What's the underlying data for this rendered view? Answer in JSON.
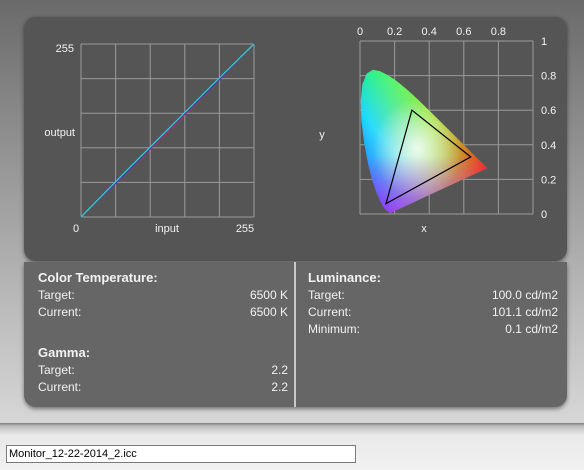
{
  "gamma_chart": {
    "xlabel": "input",
    "ylabel": "output",
    "x_ticks": [
      "0",
      "255"
    ],
    "y_ticks": [
      "255"
    ]
  },
  "cie_chart": {
    "xlabel": "x",
    "ylabel": "y",
    "x_ticks": [
      "0",
      "0.2",
      "0.4",
      "0.6",
      "0.8"
    ],
    "y_ticks": [
      "1",
      "0.8",
      "0.6",
      "0.4",
      "0.2",
      "0"
    ]
  },
  "chart_data": [
    {
      "type": "line",
      "xlabel": "input",
      "ylabel": "output",
      "xlim": [
        0,
        255
      ],
      "ylim": [
        0,
        255
      ],
      "grid": true,
      "series": [
        {
          "color": "#2f9a2f",
          "x": [
            0,
            64,
            128,
            192,
            255
          ],
          "y": [
            0,
            64,
            128,
            192,
            255
          ]
        },
        {
          "color": "#c02a6a",
          "x": [
            0,
            64,
            128,
            192,
            255
          ],
          "y": [
            0,
            62,
            126,
            190,
            255
          ]
        },
        {
          "color": "#2f2fb8",
          "x": [
            0,
            64,
            128,
            192,
            255
          ],
          "y": [
            0,
            63,
            128,
            191,
            255
          ]
        },
        {
          "color": "#33cccc",
          "x": [
            0,
            64,
            128,
            192,
            255
          ],
          "y": [
            0,
            65,
            129,
            193,
            255
          ]
        }
      ]
    },
    {
      "type": "scatter",
      "xlabel": "x",
      "ylabel": "y",
      "xlim": [
        0,
        1
      ],
      "ylim": [
        0,
        1
      ],
      "grid": true,
      "gamut_triangle": {
        "red": [
          0.64,
          0.33
        ],
        "green": [
          0.3,
          0.6
        ],
        "blue": [
          0.15,
          0.06
        ]
      },
      "white_point": [
        0.3127,
        0.329
      ]
    }
  ],
  "color_temperature": {
    "heading": "Color Temperature:",
    "target_label": "Target:",
    "target_value": "6500 K",
    "current_label": "Current:",
    "current_value": "6500 K"
  },
  "gamma": {
    "heading": "Gamma:",
    "target_label": "Target:",
    "target_value": "2.2",
    "current_label": "Current:",
    "current_value": "2.2"
  },
  "luminance": {
    "heading": "Luminance:",
    "target_label": "Target:",
    "target_value": "100.0 cd/m2",
    "current_label": "Current:",
    "current_value": "101.1 cd/m2",
    "minimum_label": "Minimum:",
    "minimum_value": "0.1 cd/m2"
  },
  "profile_file": {
    "value": "Monitor_12-22-2014_2.icc"
  },
  "colors": {
    "panel": "#555555",
    "grid": "#9a9a9a",
    "text": "#f2f2f2"
  }
}
